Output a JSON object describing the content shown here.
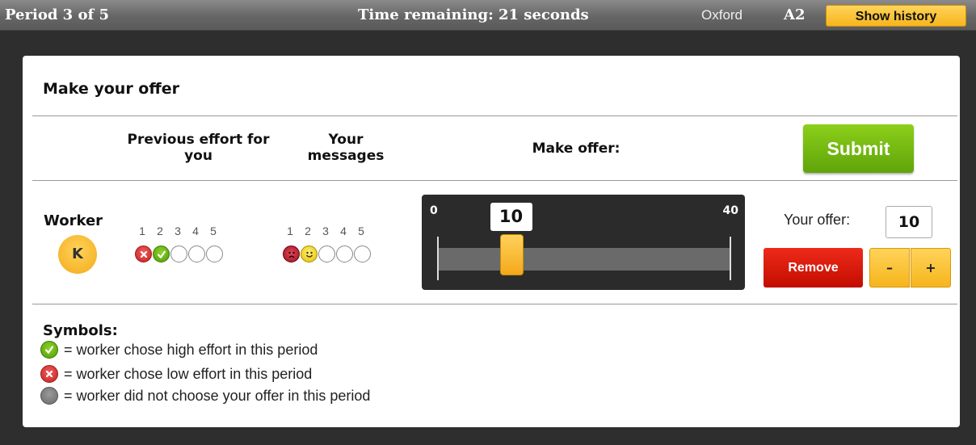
{
  "topbar": {
    "period": "Period 3 of 5",
    "time_remaining": "Time remaining: 21 seconds",
    "city": "Oxford",
    "code": "A2",
    "history_button": "Show history"
  },
  "card": {
    "title": "Make your offer",
    "columns": {
      "previous_effort": "Previous effort for you",
      "your_messages": "Your messages",
      "make_offer": "Make offer:"
    },
    "submit_label": "Submit"
  },
  "worker": {
    "label": "Worker",
    "avatar_initial": "K",
    "effort_numbers": [
      "1",
      "2",
      "3",
      "4",
      "5"
    ],
    "effort_states": [
      "low",
      "high",
      "none",
      "none",
      "none"
    ],
    "message_numbers": [
      "1",
      "2",
      "3",
      "4",
      "5"
    ],
    "message_states": [
      "angry",
      "happy",
      "none",
      "none",
      "none"
    ]
  },
  "slider": {
    "min": "0",
    "max": "40",
    "value": "10",
    "value_fraction": 0.25
  },
  "offer": {
    "label": "Your offer:",
    "value": "10",
    "remove_label": "Remove",
    "minus_label": "–",
    "plus_label": "+"
  },
  "symbols": {
    "title": "Symbols:",
    "high": "= worker chose high effort in this period",
    "low": "= worker chose low effort in this period",
    "none": "= worker did not choose your offer in this period"
  },
  "colors": {
    "accent_yellow": "#f6b51c",
    "submit_green": "#5fa40a",
    "remove_red": "#c20d00"
  }
}
